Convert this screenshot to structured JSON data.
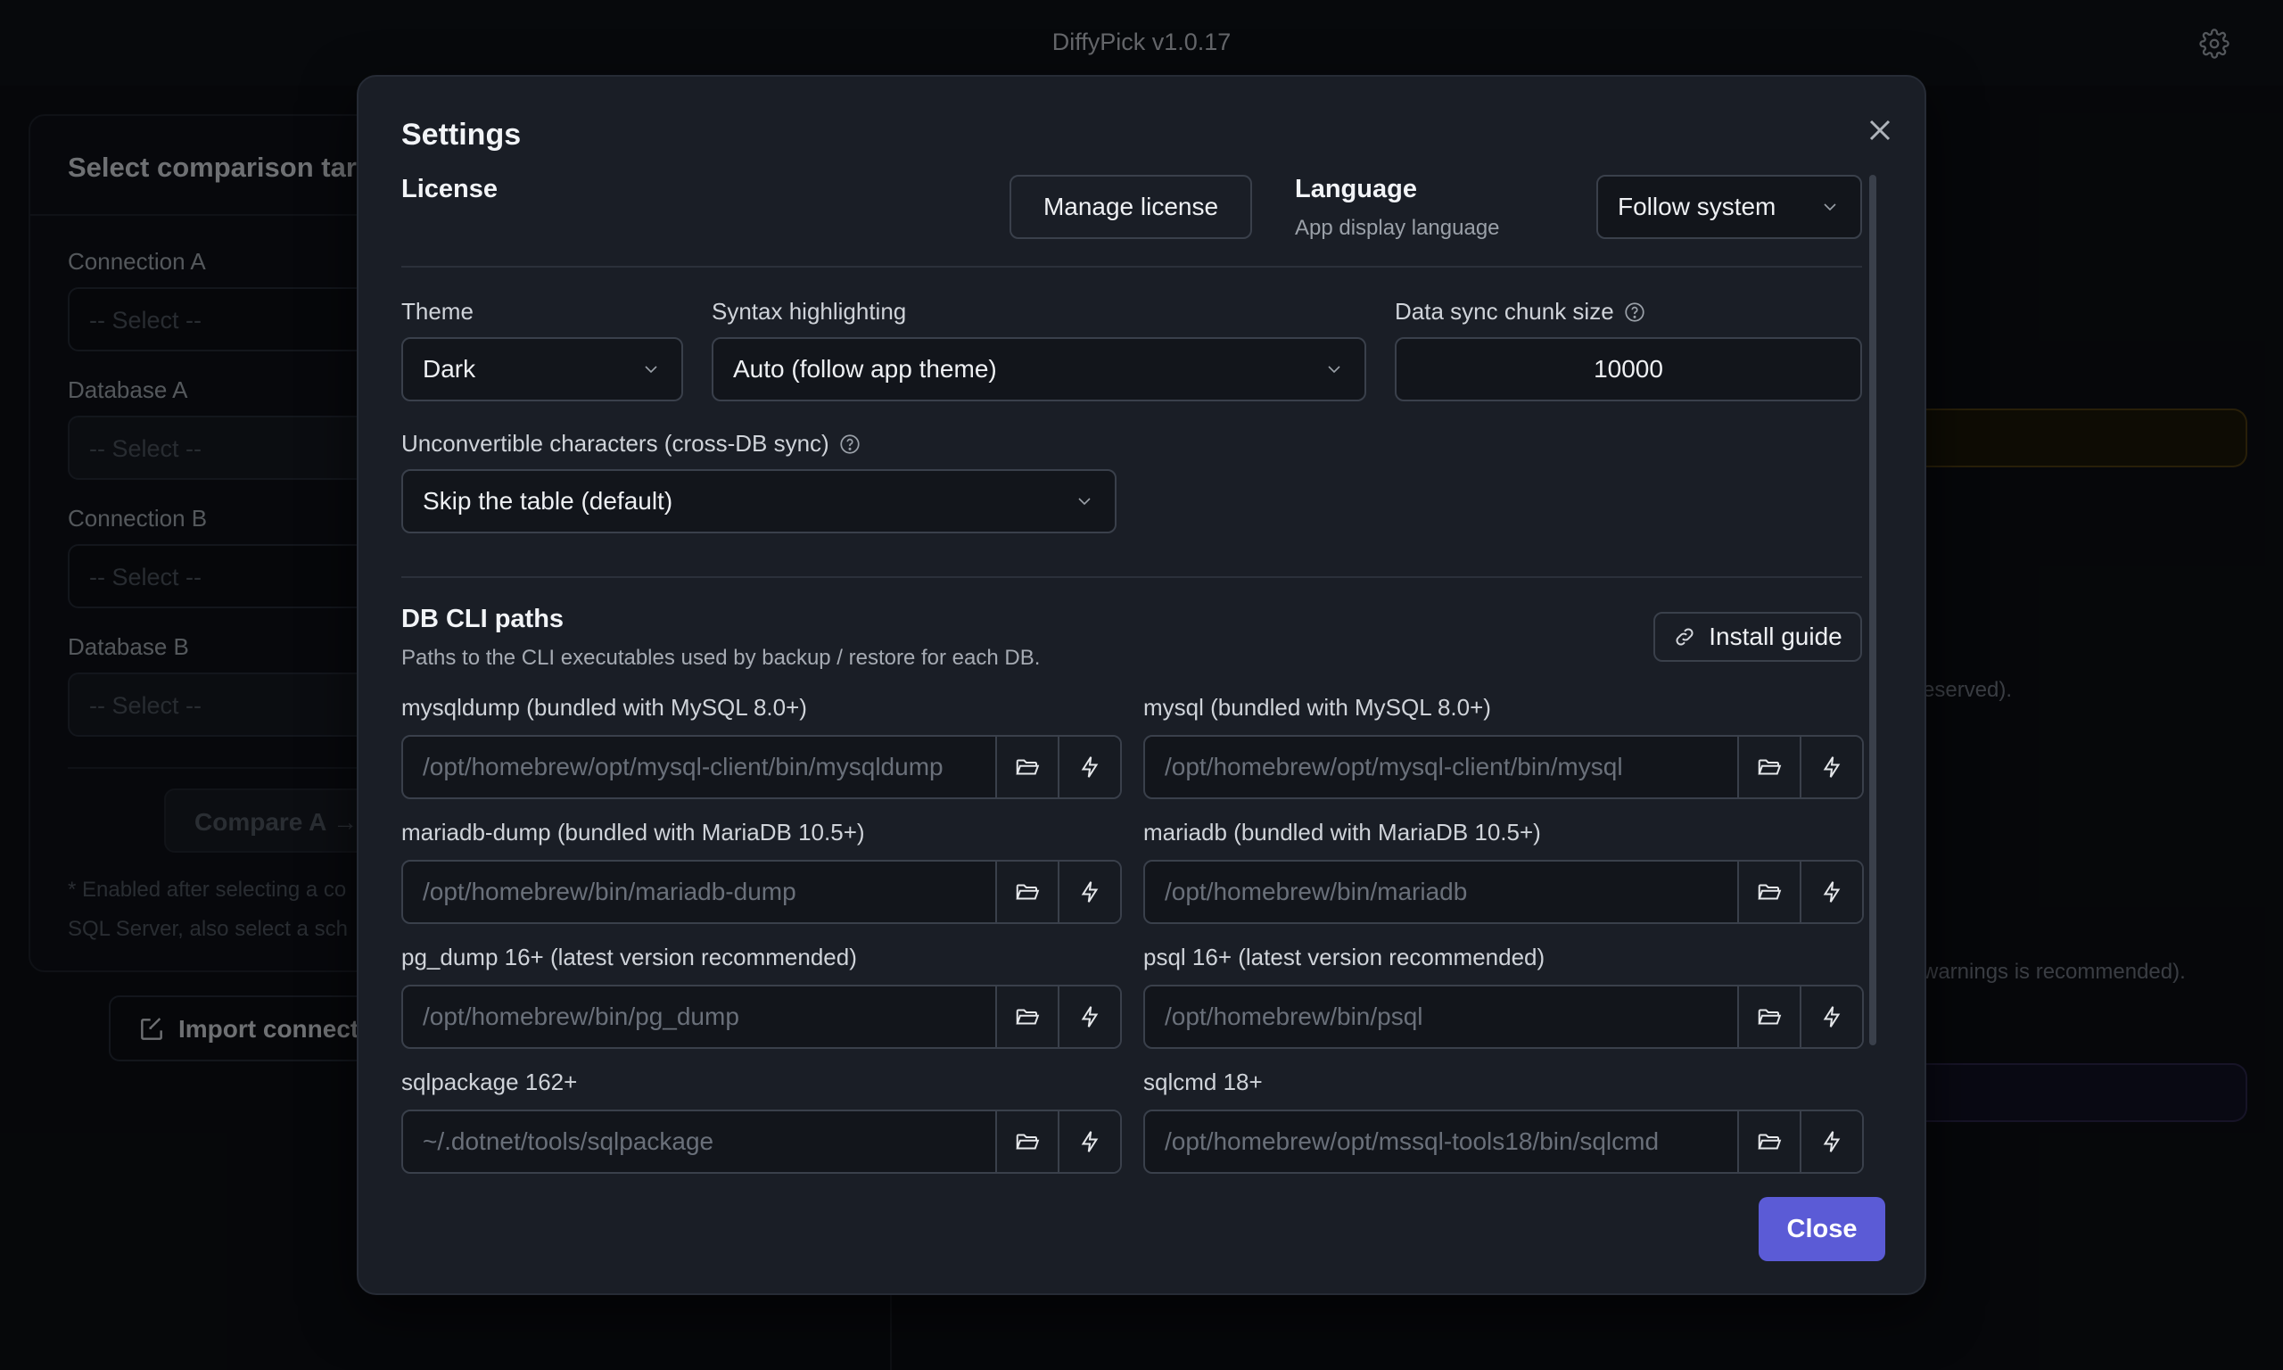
{
  "app": {
    "title": "DiffyPick v1.0.17"
  },
  "background": {
    "panel_title": "Select comparison targ",
    "connection_a_label": "Connection A",
    "database_a_label": "Database A",
    "connection_b_label": "Connection B",
    "database_b_label": "Database B",
    "select_placeholder": "-- Select --",
    "compare_label": "Compare A →",
    "note_line1": "* Enabled after selecting a co",
    "note_line2": "SQL Server, also select a sch",
    "import_label": "Import connect",
    "right_text1": "eserved).",
    "right_text2": "warnings is recommended)."
  },
  "settings": {
    "title": "Settings",
    "license": {
      "label": "License",
      "button": "Manage license"
    },
    "language": {
      "label": "Language",
      "sublabel": "App display language",
      "value": "Follow system"
    },
    "theme": {
      "label": "Theme",
      "value": "Dark"
    },
    "syntax": {
      "label": "Syntax highlighting",
      "value": "Auto (follow app theme)"
    },
    "chunk": {
      "label": "Data sync chunk size",
      "value": "10000"
    },
    "unconvertible": {
      "label": "Unconvertible characters (cross-DB sync)",
      "value": "Skip the table (default)"
    },
    "cli": {
      "title": "DB CLI paths",
      "subtitle": "Paths to the CLI executables used by backup / restore for each DB.",
      "install_guide": "Install guide",
      "paths": [
        {
          "label": "mysqldump (bundled with MySQL 8.0+)",
          "placeholder": "/opt/homebrew/opt/mysql-client/bin/mysqldump"
        },
        {
          "label": "mysql (bundled with MySQL 8.0+)",
          "placeholder": "/opt/homebrew/opt/mysql-client/bin/mysql"
        },
        {
          "label": "mariadb-dump (bundled with MariaDB 10.5+)",
          "placeholder": "/opt/homebrew/bin/mariadb-dump"
        },
        {
          "label": "mariadb (bundled with MariaDB 10.5+)",
          "placeholder": "/opt/homebrew/bin/mariadb"
        },
        {
          "label": "pg_dump 16+ (latest version recommended)",
          "placeholder": "/opt/homebrew/bin/pg_dump"
        },
        {
          "label": "psql 16+ (latest version recommended)",
          "placeholder": "/opt/homebrew/bin/psql"
        },
        {
          "label": "sqlpackage 162+",
          "placeholder": "~/.dotnet/tools/sqlpackage"
        },
        {
          "label": "sqlcmd 18+",
          "placeholder": "/opt/homebrew/opt/mssql-tools18/bin/sqlcmd"
        }
      ]
    },
    "close_button": "Close"
  },
  "colors": {
    "accent": "#5b5bd6",
    "modal_bg": "#1a1e26",
    "page_bg": "#0b0e13"
  }
}
